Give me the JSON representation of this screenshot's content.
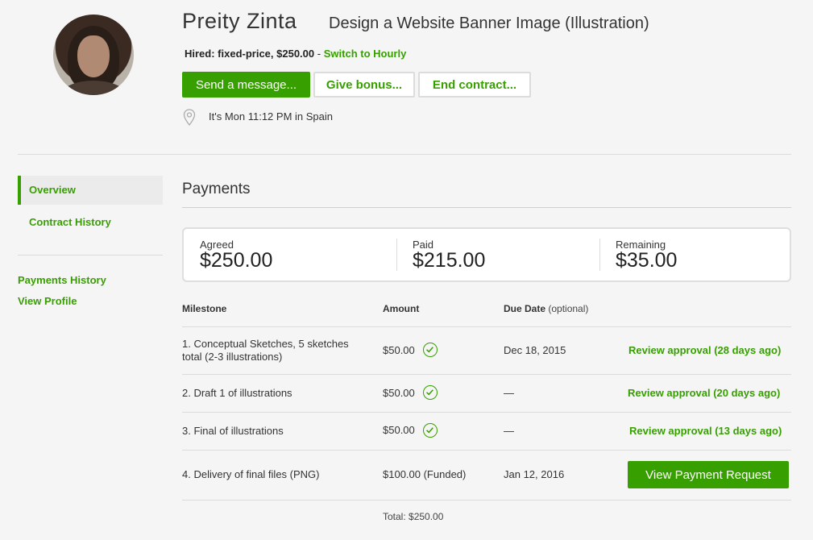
{
  "header": {
    "freelancer_name": "Preity Zinta",
    "contract_title": "Design a Website Banner Image (Illustration)",
    "hired_label": "Hired: fixed-price, $250.00",
    "hired_sep": "-",
    "switch_link": "Switch to Hourly",
    "buttons": {
      "send_message": "Send a message...",
      "give_bonus": "Give bonus...",
      "end_contract": "End contract..."
    },
    "location_text": "It's Mon 11:12 PM in Spain",
    "location_icon": "map-pin-icon"
  },
  "sidebar": {
    "overview": "Overview",
    "contract_history": "Contract History",
    "payments_history": "Payments History",
    "view_profile": "View Profile"
  },
  "payments": {
    "title": "Payments",
    "summary": {
      "agreed_label": "Agreed",
      "agreed_value": "$250.00",
      "paid_label": "Paid",
      "paid_value": "$215.00",
      "remaining_label": "Remaining",
      "remaining_value": "$35.00"
    },
    "columns": {
      "milestone": "Milestone",
      "amount": "Amount",
      "due_date": "Due Date",
      "due_date_note": "(optional)"
    },
    "rows": [
      {
        "name": "1. Conceptual Sketches, 5 sketches total (2-3 illustrations)",
        "amount": "$50.00",
        "status_icon": "check-circle-icon",
        "due": "Dec 18, 2015",
        "action": "Review approval (28 days ago)"
      },
      {
        "name": "2. Draft 1 of illustrations",
        "amount": "$50.00",
        "status_icon": "check-circle-icon",
        "due": "—",
        "action": "Review approval (20 days ago)"
      },
      {
        "name": "3. Final of illustrations",
        "amount": "$50.00",
        "status_icon": "check-circle-icon",
        "due": "—",
        "action": "Review approval (13 days ago)"
      },
      {
        "name": "4. Delivery of final files (PNG)",
        "amount": "$100.00 (Funded)",
        "due": "Jan 12, 2016",
        "action": "View Payment Request"
      }
    ],
    "total": "Total: $250.00"
  },
  "colors": {
    "accent": "#37a000"
  }
}
